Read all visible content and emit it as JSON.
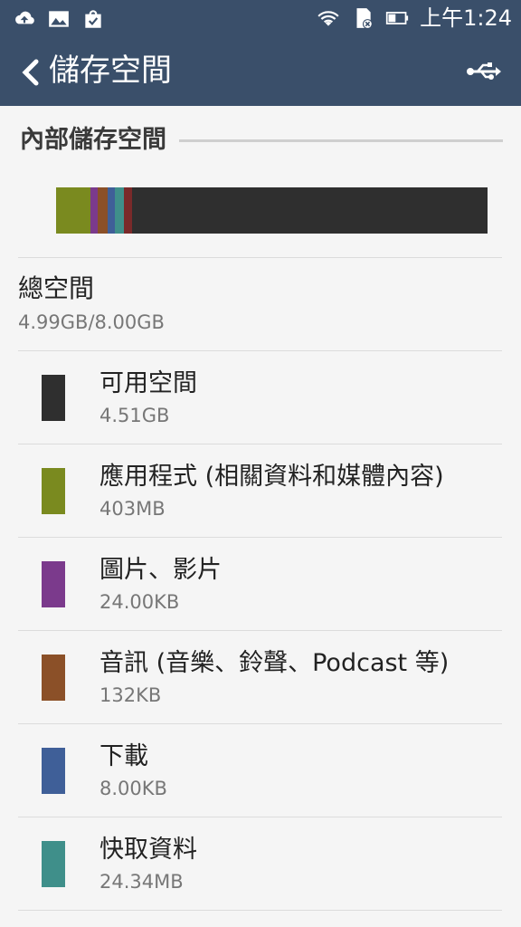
{
  "status_bar": {
    "time": "上午1:24",
    "icons": [
      "upload-cloud-icon",
      "image-icon",
      "bag-check-icon",
      "wifi-icon",
      "sd-card-error-icon",
      "battery-icon"
    ]
  },
  "toolbar": {
    "title": "儲存空間",
    "back_icon": "chevron-left-icon",
    "usb_icon": "usb-icon"
  },
  "section": {
    "title": "內部儲存空間"
  },
  "storage_bar": {
    "segments": [
      {
        "name": "apps",
        "fraction": 0.079,
        "color": "#7a8a1f"
      },
      {
        "name": "pictures",
        "fraction": 0.017,
        "color": "#7b3a8c"
      },
      {
        "name": "audio",
        "fraction": 0.023,
        "color": "#8b5028"
      },
      {
        "name": "downloads",
        "fraction": 0.017,
        "color": "#3f5f98"
      },
      {
        "name": "cache",
        "fraction": 0.021,
        "color": "#3f8f8a"
      },
      {
        "name": "misc",
        "fraction": 0.02,
        "color": "#7a2a2a"
      },
      {
        "name": "available",
        "fraction": 0.823,
        "color": "#2f2f2f"
      }
    ]
  },
  "total": {
    "label": "總空間",
    "value": "4.99GB/8.00GB"
  },
  "items": [
    {
      "label": "可用空間",
      "value": "4.51GB",
      "color": "#2f2f2f"
    },
    {
      "label": "應用程式 (相關資料和媒體內容)",
      "value": "403MB",
      "color": "#7a8a1f"
    },
    {
      "label": "圖片、影片",
      "value": "24.00KB",
      "color": "#7b3a8c"
    },
    {
      "label": "音訊 (音樂、鈴聲、Podcast 等)",
      "value": "132KB",
      "color": "#8b5028"
    },
    {
      "label": "下載",
      "value": "8.00KB",
      "color": "#3f5f98"
    },
    {
      "label": "快取資料",
      "value": "24.34MB",
      "color": "#3f8f8a"
    }
  ]
}
